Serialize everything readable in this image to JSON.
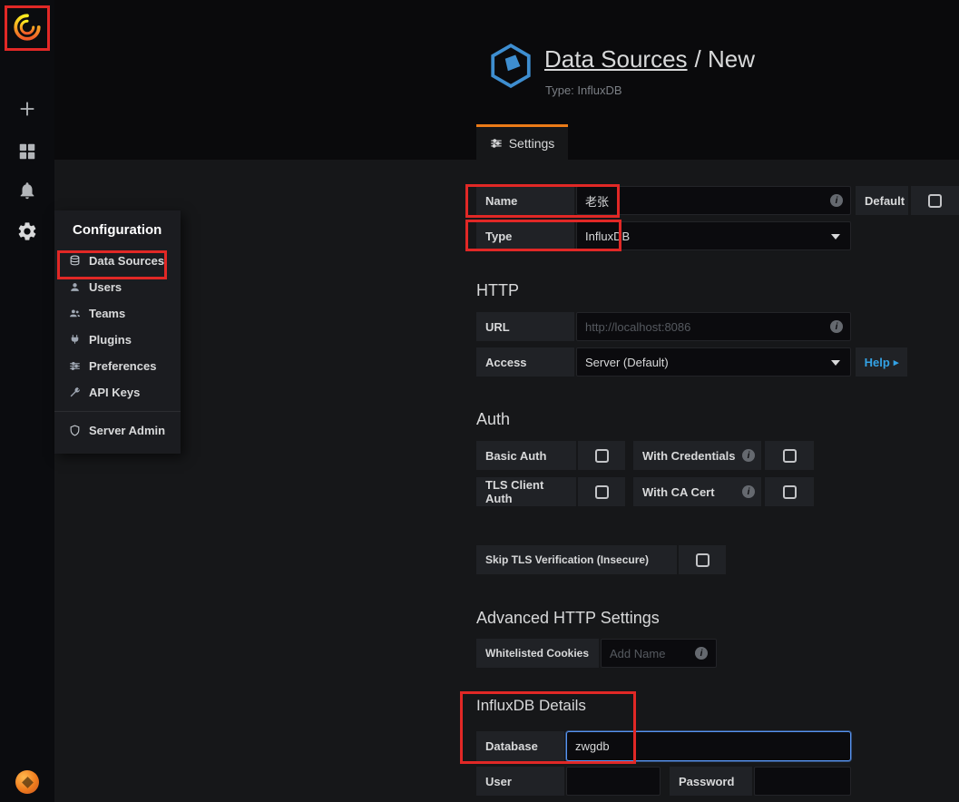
{
  "colors": {
    "accent_orange": "#eb7b18",
    "link_blue": "#33a2e5",
    "annotation_red": "#e12826"
  },
  "icons": {
    "info_glyph": "i",
    "caret_right_glyph": "▸"
  },
  "config_menu": {
    "title": "Configuration",
    "items": [
      {
        "label": "Data Sources"
      },
      {
        "label": "Users"
      },
      {
        "label": "Teams"
      },
      {
        "label": "Plugins"
      },
      {
        "label": "Preferences"
      },
      {
        "label": "API Keys"
      },
      {
        "label": "Server Admin"
      }
    ]
  },
  "header": {
    "title_link": "Data Sources",
    "title_rest": "/ New",
    "subtitle": "Type: InfluxDB"
  },
  "tabs": {
    "settings": "Settings"
  },
  "form": {
    "name": {
      "label": "Name",
      "value": "老张",
      "default_label": "Default"
    },
    "type": {
      "label": "Type",
      "value": "InfluxDB"
    },
    "http": {
      "heading": "HTTP",
      "url_label": "URL",
      "url_placeholder": "http://localhost:8086",
      "access_label": "Access",
      "access_value": "Server (Default)",
      "help_label": "Help"
    },
    "auth": {
      "heading": "Auth",
      "basic_auth": "Basic Auth",
      "with_credentials": "With Credentials",
      "tls_client_auth": "TLS Client Auth",
      "with_ca_cert": "With CA Cert",
      "skip_tls": "Skip TLS Verification (Insecure)"
    },
    "advanced": {
      "heading": "Advanced HTTP Settings",
      "cookies_label": "Whitelisted Cookies",
      "cookies_placeholder": "Add Name"
    },
    "influx": {
      "heading": "InfluxDB Details",
      "database_label": "Database",
      "database_value": "zwgdb",
      "user_label": "User",
      "password_label": "Password"
    }
  }
}
